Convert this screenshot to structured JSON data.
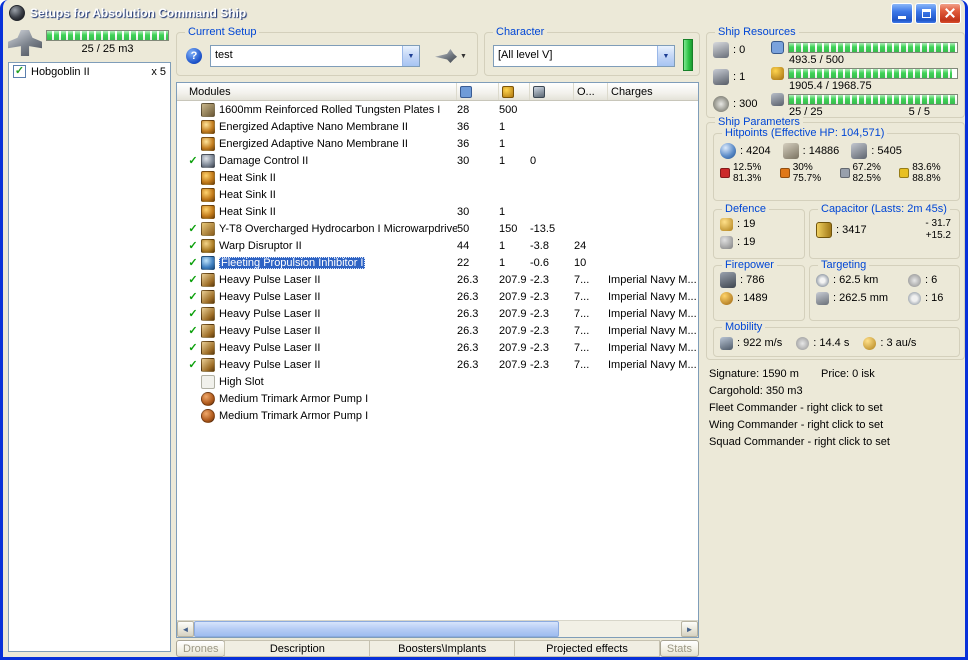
{
  "window": {
    "title": "Setups for Absolution Command Ship"
  },
  "icons": {
    "help": "?",
    "dropdown": "▼",
    "scroll_left": "◄",
    "scroll_right": "►",
    "check": "✓"
  },
  "drone_bay": {
    "capacity_label": "25 / 25 m3",
    "fill_percent": 100,
    "items": [
      {
        "name": "Hobgoblin II",
        "qty": "x 5",
        "checked": true
      }
    ]
  },
  "current_setup": {
    "label": "Current Setup",
    "value": "test"
  },
  "character": {
    "label": "Character",
    "value": "[All level V]"
  },
  "modules_table": {
    "columns": {
      "modules": "Modules",
      "optimal": "O...",
      "charges": "Charges"
    },
    "rows": [
      {
        "icon": "armor-plate",
        "check": false,
        "selected": false,
        "name": "1600mm Reinforced Rolled Tungsten Plates I",
        "cpu": "28",
        "pg": "500",
        "cap": "",
        "optimal": "",
        "charge": ""
      },
      {
        "icon": "membrane",
        "check": false,
        "selected": false,
        "name": "Energized Adaptive Nano Membrane II",
        "cpu": "36",
        "pg": "1",
        "cap": "",
        "optimal": "",
        "charge": ""
      },
      {
        "icon": "membrane",
        "check": false,
        "selected": false,
        "name": "Energized Adaptive Nano Membrane II",
        "cpu": "36",
        "pg": "1",
        "cap": "",
        "optimal": "",
        "charge": ""
      },
      {
        "icon": "damage-control",
        "check": true,
        "selected": false,
        "name": "Damage Control II",
        "cpu": "30",
        "pg": "1",
        "cap": "0",
        "optimal": "",
        "charge": ""
      },
      {
        "icon": "heat-sink",
        "check": false,
        "selected": false,
        "name": "Heat Sink II",
        "cpu": "",
        "pg": "",
        "cap": "",
        "optimal": "",
        "charge": ""
      },
      {
        "icon": "heat-sink",
        "check": false,
        "selected": false,
        "name": "Heat Sink II",
        "cpu": "",
        "pg": "",
        "cap": "",
        "optimal": "",
        "charge": ""
      },
      {
        "icon": "heat-sink",
        "check": false,
        "selected": false,
        "name": "Heat Sink II",
        "cpu": "30",
        "pg": "1",
        "cap": "",
        "optimal": "",
        "charge": ""
      },
      {
        "icon": "mwd",
        "check": true,
        "selected": false,
        "name": "Y-T8 Overcharged Hydrocarbon I Microwarpdrive",
        "cpu": "50",
        "pg": "150",
        "cap": "-13.5",
        "optimal": "",
        "charge": ""
      },
      {
        "icon": "warp-disruptor",
        "check": true,
        "selected": false,
        "name": "Warp Disruptor II",
        "cpu": "44",
        "pg": "1",
        "cap": "-3.8",
        "optimal": "24",
        "charge": ""
      },
      {
        "icon": "web",
        "check": true,
        "selected": true,
        "name": "Fleeting Propulsion Inhibitor I",
        "cpu": "22",
        "pg": "1",
        "cap": "-0.6",
        "optimal": "10",
        "charge": ""
      },
      {
        "icon": "laser",
        "check": true,
        "selected": false,
        "name": "Heavy Pulse Laser II",
        "cpu": "26.3",
        "pg": "207.9",
        "cap": "-2.3",
        "optimal": "7...",
        "charge": "Imperial Navy M..."
      },
      {
        "icon": "laser",
        "check": true,
        "selected": false,
        "name": "Heavy Pulse Laser II",
        "cpu": "26.3",
        "pg": "207.9",
        "cap": "-2.3",
        "optimal": "7...",
        "charge": "Imperial Navy M..."
      },
      {
        "icon": "laser",
        "check": true,
        "selected": false,
        "name": "Heavy Pulse Laser II",
        "cpu": "26.3",
        "pg": "207.9",
        "cap": "-2.3",
        "optimal": "7...",
        "charge": "Imperial Navy M..."
      },
      {
        "icon": "laser",
        "check": true,
        "selected": false,
        "name": "Heavy Pulse Laser II",
        "cpu": "26.3",
        "pg": "207.9",
        "cap": "-2.3",
        "optimal": "7...",
        "charge": "Imperial Navy M..."
      },
      {
        "icon": "laser",
        "check": true,
        "selected": false,
        "name": "Heavy Pulse Laser II",
        "cpu": "26.3",
        "pg": "207.9",
        "cap": "-2.3",
        "optimal": "7...",
        "charge": "Imperial Navy M..."
      },
      {
        "icon": "laser",
        "check": true,
        "selected": false,
        "name": "Heavy Pulse Laser II",
        "cpu": "26.3",
        "pg": "207.9",
        "cap": "-2.3",
        "optimal": "7...",
        "charge": "Imperial Navy M..."
      },
      {
        "icon": "empty-high",
        "check": false,
        "selected": false,
        "name": "High Slot",
        "cpu": "",
        "pg": "",
        "cap": "",
        "optimal": "",
        "charge": ""
      },
      {
        "icon": "rig",
        "check": false,
        "selected": false,
        "name": "Medium Trimark Armor Pump I",
        "cpu": "",
        "pg": "",
        "cap": "",
        "optimal": "",
        "charge": ""
      },
      {
        "icon": "rig",
        "check": false,
        "selected": false,
        "name": "Medium Trimark Armor Pump I",
        "cpu": "",
        "pg": "",
        "cap": "",
        "optimal": "",
        "charge": ""
      }
    ]
  },
  "tabs": {
    "drones": "Drones",
    "description": "Description",
    "boosters": "Boosters\\Implants",
    "projected": "Projected effects",
    "stats": "Stats"
  },
  "ship_resources": {
    "label": "Ship Resources",
    "turrets": ": 0",
    "launchers": ": 1",
    "calibration": ": 300",
    "cpu": {
      "value": "493.5 / 500",
      "percent": 99
    },
    "powergrid": {
      "value": "1905.4 / 1968.75",
      "percent": 97
    },
    "drone": {
      "value": "25 / 25",
      "extra": "5 / 5",
      "percent": 100
    }
  },
  "ship_parameters": {
    "label": "Ship Parameters",
    "hitpoints": {
      "label": "Hitpoints (Effective HP: 104,571)",
      "shield": ": 4204",
      "armor": ": 14886",
      "structure": ": 5405",
      "resists": [
        {
          "type": "em",
          "top": "12.5%",
          "bottom": "81.3%",
          "color": "#cc2a2a"
        },
        {
          "type": "thermal",
          "top": "30%",
          "bottom": "75.7%",
          "color": "#e07818"
        },
        {
          "type": "kinetic",
          "top": "67.2%",
          "bottom": "82.5%",
          "color": "#98a0ac"
        },
        {
          "type": "explosive",
          "top": "83.6%",
          "bottom": "88.8%",
          "color": "#e8c022"
        }
      ]
    },
    "defence": {
      "label": "Defence",
      "values": [
        ": 19",
        ": 19"
      ]
    },
    "capacitor": {
      "label": "Capacitor (Lasts: 2m 45s)",
      "value": ": 3417",
      "drain": "- 31.7",
      "recharge": "+15.2"
    },
    "firepower": {
      "label": "Firepower",
      "dps": ": 786",
      "volley": ": 1489"
    },
    "targeting": {
      "label": "Targeting",
      "range": ": 62.5 km",
      "max_targets": ": 6",
      "resolution": ": 262.5 mm",
      "sensor_strength": ": 16"
    },
    "mobility": {
      "label": "Mobility",
      "speed": ": 922 m/s",
      "align": ": 14.4 s",
      "warp": ": 3 au/s"
    }
  },
  "footer": {
    "signature": "Signature: 1590 m",
    "price": "Price: 0 isk",
    "cargohold": "Cargohold: 350 m3",
    "fleet": "Fleet Commander - right click to set",
    "wing": "Wing Commander - right click to set",
    "squad": "Squad Commander - right click to set"
  }
}
